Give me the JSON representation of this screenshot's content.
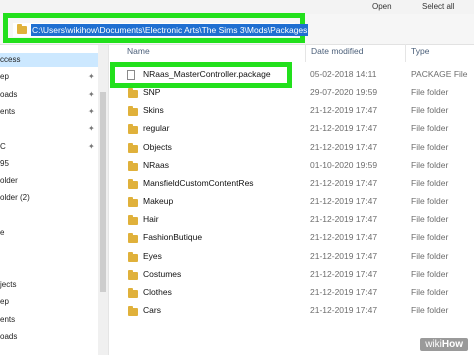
{
  "toolbar": {
    "open_label": "Open",
    "select_all_label": "Select all"
  },
  "address": {
    "path": "C:\\Users\\wikihow\\Documents\\Electronic Arts\\The Sims 3\\Mods\\Packages"
  },
  "columns": {
    "name": "Name",
    "date": "Date modified",
    "type": "Type"
  },
  "nav": {
    "items": [
      {
        "label": "ccess",
        "selected": true
      },
      {
        "label": "ep",
        "pinned": true
      },
      {
        "label": "oads",
        "pinned": true
      },
      {
        "label": "ents",
        "pinned": true
      },
      {
        "label": "",
        "pinned": true
      },
      {
        "label": "C",
        "pinned": true
      },
      {
        "label": "95"
      },
      {
        "label": "older"
      },
      {
        "label": "older (2)"
      },
      {
        "label": ""
      },
      {
        "label": "e"
      },
      {
        "label": ""
      },
      {
        "label": ""
      },
      {
        "label": "jects"
      },
      {
        "label": "ep"
      },
      {
        "label": "ents"
      },
      {
        "label": "oads"
      }
    ]
  },
  "files": [
    {
      "name": "NRaas_MasterController.package",
      "date": "05-02-2018 14:11",
      "type": "PACKAGE File",
      "kind": "file"
    },
    {
      "name": "SNP",
      "date": "29-07-2020 19:59",
      "type": "File folder",
      "kind": "folder"
    },
    {
      "name": "Skins",
      "date": "21-12-2019 17:47",
      "type": "File folder",
      "kind": "folder"
    },
    {
      "name": "regular",
      "date": "21-12-2019 17:47",
      "type": "File folder",
      "kind": "folder"
    },
    {
      "name": "Objects",
      "date": "21-12-2019 17:47",
      "type": "File folder",
      "kind": "folder"
    },
    {
      "name": "NRaas",
      "date": "01-10-2020 19:59",
      "type": "File folder",
      "kind": "folder"
    },
    {
      "name": "MansfieldCustomContentRes",
      "date": "21-12-2019 17:47",
      "type": "File folder",
      "kind": "folder"
    },
    {
      "name": "Makeup",
      "date": "21-12-2019 17:47",
      "type": "File folder",
      "kind": "folder"
    },
    {
      "name": "Hair",
      "date": "21-12-2019 17:47",
      "type": "File folder",
      "kind": "folder"
    },
    {
      "name": "FashionButique",
      "date": "21-12-2019 17:47",
      "type": "File folder",
      "kind": "folder"
    },
    {
      "name": "Eyes",
      "date": "21-12-2019 17:47",
      "type": "File folder",
      "kind": "folder"
    },
    {
      "name": "Costumes",
      "date": "21-12-2019 17:47",
      "type": "File folder",
      "kind": "folder"
    },
    {
      "name": "Clothes",
      "date": "21-12-2019 17:47",
      "type": "File folder",
      "kind": "folder"
    },
    {
      "name": "Cars",
      "date": "21-12-2019 17:47",
      "type": "File folder",
      "kind": "folder"
    }
  ],
  "watermark": {
    "prefix": "wiki",
    "suffix": "How"
  },
  "colors": {
    "highlight": "#22e01c",
    "selection": "#1f6fd1",
    "folder": "#e0b13b"
  }
}
